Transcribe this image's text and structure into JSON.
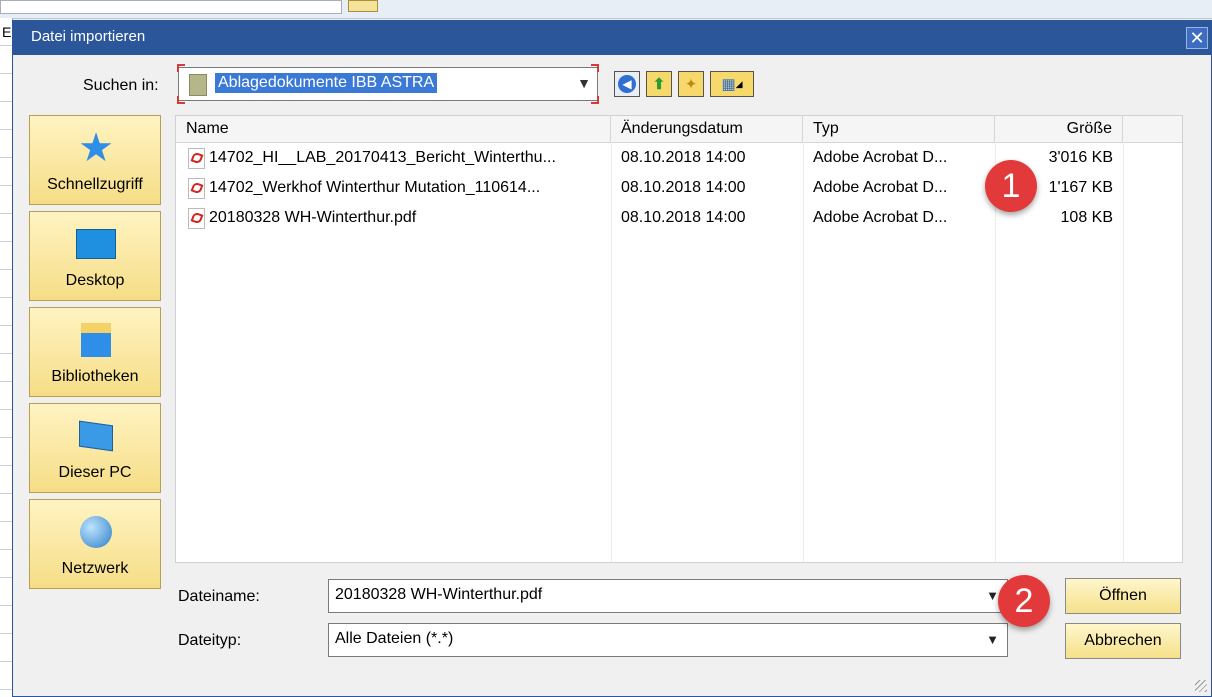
{
  "dialog": {
    "title": "Datei importieren",
    "close_symbol": "✕"
  },
  "background": {
    "left_char": "E"
  },
  "lookin": {
    "label": "Suchen in:",
    "value": "Ablagedokumente IBB ASTRA"
  },
  "toolbar": {
    "icons": [
      "back-icon",
      "up-folder-icon",
      "new-folder-icon",
      "view-menu-icon"
    ]
  },
  "places": [
    {
      "label": "Schnellzugriff",
      "icon": "star-icon"
    },
    {
      "label": "Desktop",
      "icon": "desktop-icon"
    },
    {
      "label": "Bibliotheken",
      "icon": "libraries-icon"
    },
    {
      "label": "Dieser PC",
      "icon": "computer-icon"
    },
    {
      "label": "Netzwerk",
      "icon": "network-icon"
    }
  ],
  "columns": [
    "Name",
    "Änderungsdatum",
    "Typ",
    "Größe"
  ],
  "files": [
    {
      "name": "14702_HI__LAB_20170413_Bericht_Winterthu...",
      "date": "08.10.2018 14:00",
      "type": "Adobe Acrobat D...",
      "size": "3'016 KB"
    },
    {
      "name": "14702_Werkhof Winterthur Mutation_110614...",
      "date": "08.10.2018 14:00",
      "type": "Adobe Acrobat D...",
      "size": "1'167 KB"
    },
    {
      "name": "20180328 WH-Winterthur.pdf",
      "date": "08.10.2018 14:00",
      "type": "Adobe Acrobat D...",
      "size": "108 KB"
    }
  ],
  "filename": {
    "label": "Dateiname:",
    "value": "20180328 WH-Winterthur.pdf"
  },
  "filetype": {
    "label": "Dateityp:",
    "value": "Alle Dateien (*.*)"
  },
  "buttons": {
    "open": "Öffnen",
    "cancel": "Abbrechen"
  },
  "badges": [
    "1",
    "2"
  ],
  "colors": {
    "titlebar": "#2b579a",
    "place_bg": "#f6de86",
    "badge": "#e23a3a",
    "selection": "#3b79d6"
  }
}
